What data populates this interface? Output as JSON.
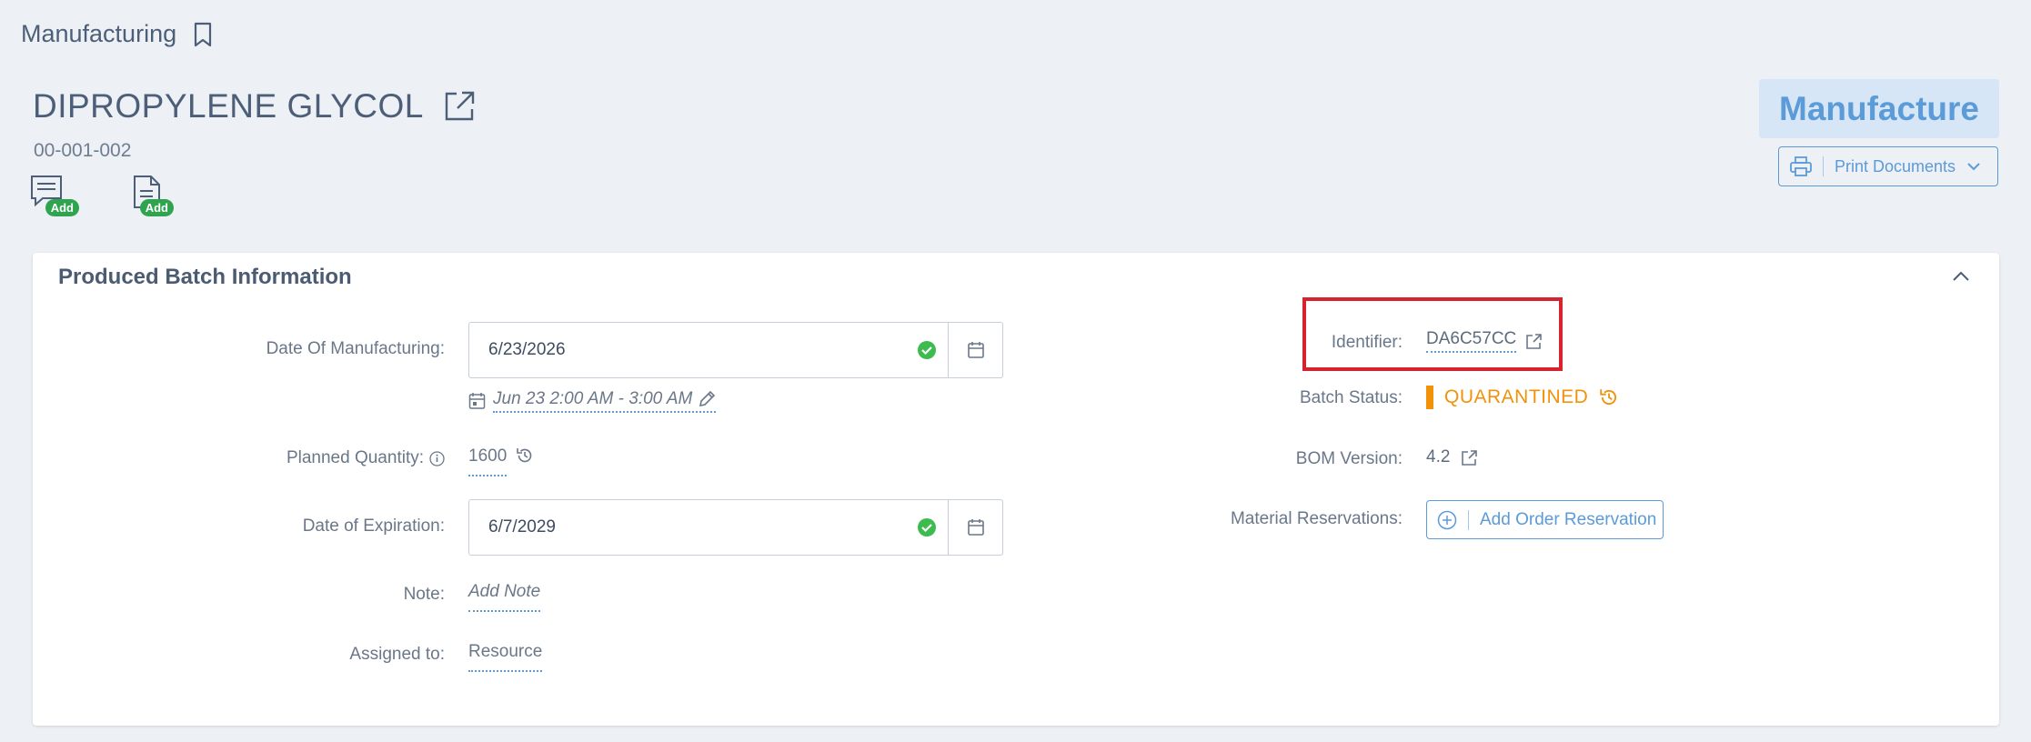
{
  "breadcrumb": {
    "label": "Manufacturing",
    "bookmark_icon": "bookmark-icon"
  },
  "header": {
    "title": "DIPROPYLENE GLYCOL",
    "code": "00-001-002",
    "add_note_badge": "Add",
    "add_doc_badge": "Add",
    "manufacture_label": "Manufacture",
    "print_label": "Print Documents"
  },
  "card": {
    "title": "Produced Batch Information",
    "left": {
      "date_mfg_label": "Date Of Manufacturing:",
      "date_mfg_value": "6/23/2026",
      "slot_text": "Jun 23 2:00 AM - 3:00 AM",
      "planned_qty_label": "Planned Quantity:",
      "planned_qty_value": "1600",
      "date_exp_label": "Date of Expiration:",
      "date_exp_value": "6/7/2029",
      "note_label": "Note:",
      "note_placeholder": "Add Note",
      "assigned_label": "Assigned to:",
      "assigned_value": "Resource"
    },
    "right": {
      "identifier_label": "Identifier:",
      "identifier_value": "DA6C57CC",
      "batch_status_label": "Batch Status:",
      "batch_status_value": "QUARANTINED",
      "bom_label": "BOM Version:",
      "bom_value": "4.2",
      "reservations_label": "Material Reservations:",
      "reservation_button": "Add Order Reservation"
    }
  },
  "colors": {
    "accent": "#5b9bd8",
    "status": "#f2920a",
    "success": "#2ea44f",
    "highlight": "#d7232d"
  }
}
